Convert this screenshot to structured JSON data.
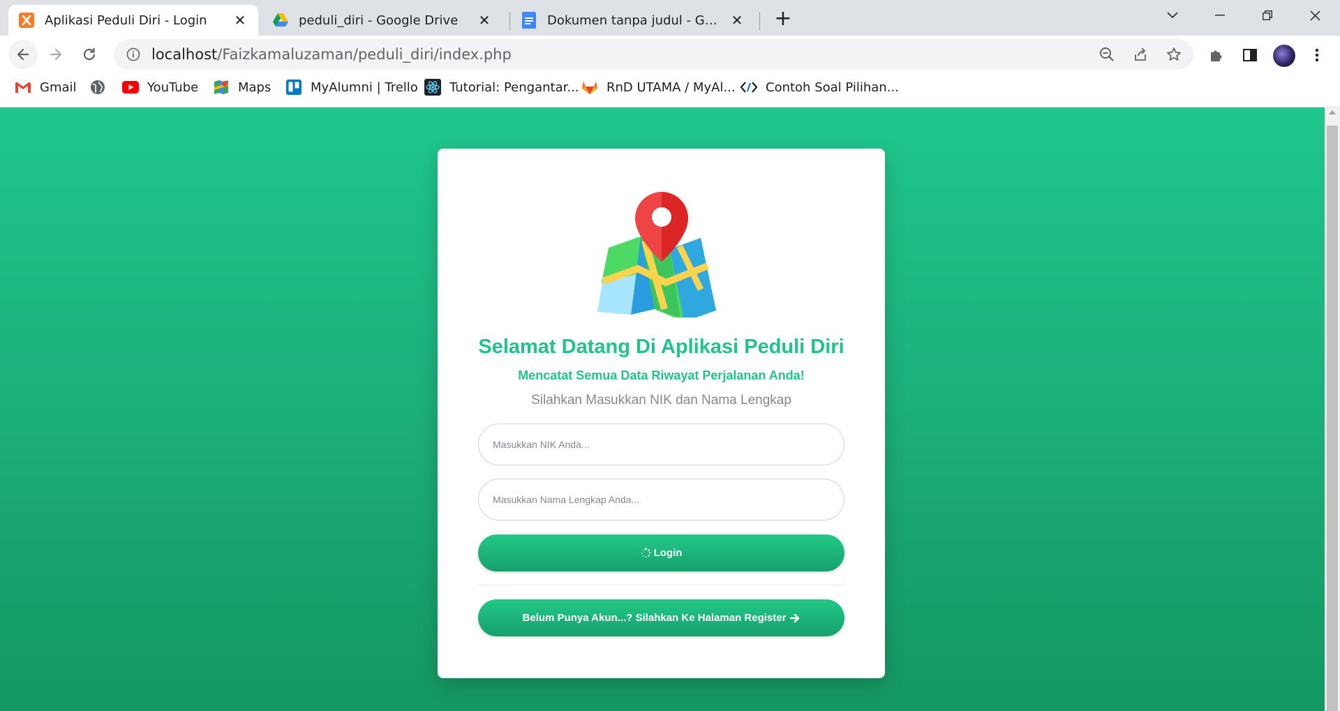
{
  "browser": {
    "tabs": [
      {
        "title": "Aplikasi Peduli Diri - Login",
        "active": true,
        "icon": "xampp-icon"
      },
      {
        "title": "peduli_diri - Google Drive",
        "active": false,
        "icon": "google-drive-icon"
      },
      {
        "title": "Dokumen tanpa judul - Google Dokumen",
        "active": false,
        "icon": "google-docs-icon"
      }
    ],
    "address": {
      "host": "localhost",
      "path": "/Faizkamaluzaman/peduli_diri/index.php"
    },
    "bookmarks": [
      {
        "label": "Gmail",
        "icon": "gmail-icon"
      },
      {
        "label": "",
        "icon": "globe-icon"
      },
      {
        "label": "YouTube",
        "icon": "youtube-icon"
      },
      {
        "label": "Maps",
        "icon": "maps-icon"
      },
      {
        "label": "MyAlumni | Trello",
        "icon": "trello-icon"
      },
      {
        "label": "Tutorial: Pengantar...",
        "icon": "react-icon"
      },
      {
        "label": "RnD UTAMA / MyAl...",
        "icon": "gitlab-icon"
      },
      {
        "label": "Contoh Soal Pilihan...",
        "icon": "code-icon"
      }
    ]
  },
  "page": {
    "title": "Selamat Datang Di Aplikasi Peduli Diri",
    "subtitle": "Mencatat Semua Data Riwayat Perjalanan Anda!",
    "hint": "Silahkan Masukkan NIK dan Nama Lengkap",
    "nik_placeholder": "Masukkan NIK Anda...",
    "name_placeholder": "Masukkan Nama Lengkap Anda...",
    "login_label": "Login",
    "register_label": "Belum Punya Akun...? Silahkan Ke Halaman Register"
  },
  "colors": {
    "accent": "#1fc48a",
    "background_top": "#1fc78c",
    "background_bottom": "#149762"
  }
}
